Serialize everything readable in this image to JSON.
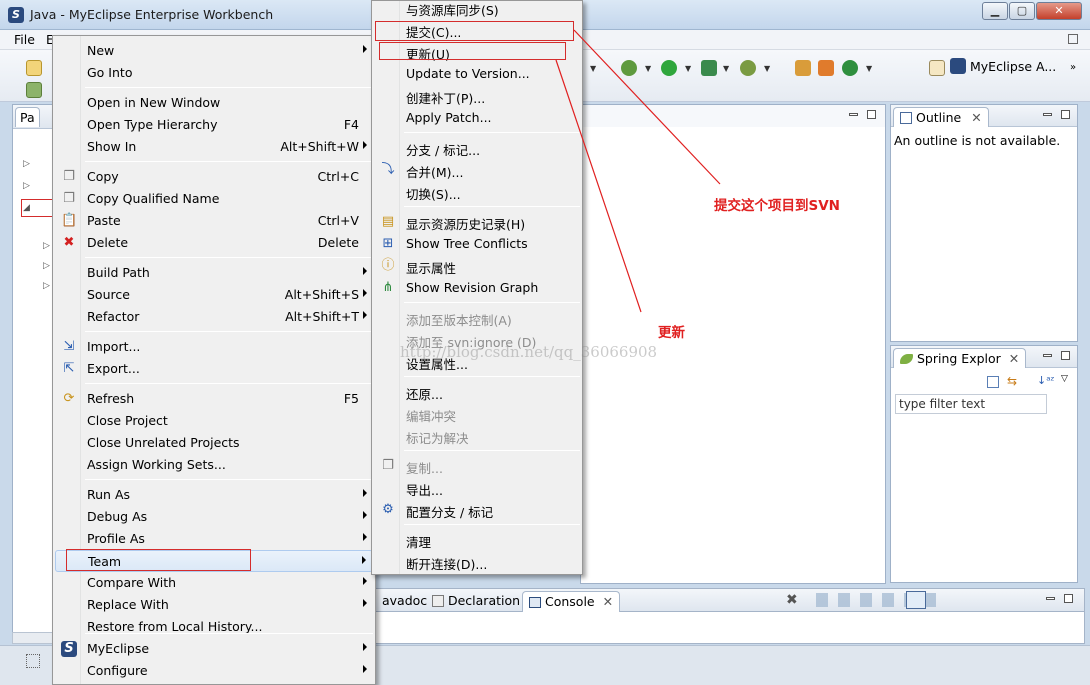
{
  "window": {
    "title": "Java - MyEclipse Enterprise Workbench",
    "min_label": "▁",
    "max_label": "▢",
    "close_label": "✕"
  },
  "menubar": {
    "file": "File",
    "edit_partial": "E"
  },
  "perspective": {
    "label": "MyEclipse A..."
  },
  "package_explorer": {
    "tab_partial": "Pa"
  },
  "outline": {
    "tab": "Outline",
    "message": "An outline is not available."
  },
  "spring": {
    "tab": "Spring Explor",
    "filter_placeholder": "type filter text"
  },
  "bottom_tabs": {
    "javadoc_partial": "avadoc",
    "declaration": "Declaration",
    "console": "Console"
  },
  "context_menu": {
    "items": [
      {
        "label": "New",
        "submenu": true
      },
      {
        "label": "Go Into"
      },
      {
        "label": "Open in New Window"
      },
      {
        "label": "Open Type Hierarchy",
        "shortcut": "F4"
      },
      {
        "label": "Show In",
        "shortcut": "Alt+Shift+W",
        "submenu": true
      },
      {
        "label": "Copy",
        "shortcut": "Ctrl+C",
        "icon": "copy-icon"
      },
      {
        "label": "Copy Qualified Name",
        "icon": "copy-qualified-icon"
      },
      {
        "label": "Paste",
        "shortcut": "Ctrl+V",
        "icon": "paste-icon"
      },
      {
        "label": "Delete",
        "shortcut": "Delete",
        "icon": "delete-icon"
      },
      {
        "label": "Build Path",
        "submenu": true
      },
      {
        "label": "Source",
        "shortcut": "Alt+Shift+S",
        "submenu": true
      },
      {
        "label": "Refactor",
        "shortcut": "Alt+Shift+T",
        "submenu": true
      },
      {
        "label": "Import...",
        "icon": "import-icon"
      },
      {
        "label": "Export...",
        "icon": "export-icon"
      },
      {
        "label": "Refresh",
        "shortcut": "F5",
        "icon": "refresh-icon"
      },
      {
        "label": "Close Project"
      },
      {
        "label": "Close Unrelated Projects"
      },
      {
        "label": "Assign Working Sets..."
      },
      {
        "label": "Run As",
        "submenu": true
      },
      {
        "label": "Debug As",
        "submenu": true
      },
      {
        "label": "Profile As",
        "submenu": true
      },
      {
        "label": "Team",
        "submenu": true,
        "highlighted": true
      },
      {
        "label": "Compare With",
        "submenu": true
      },
      {
        "label": "Replace With",
        "submenu": true
      },
      {
        "label": "Restore from Local History..."
      },
      {
        "label": "MyEclipse",
        "submenu": true,
        "icon": "myeclipse-icon"
      },
      {
        "label": "Configure",
        "submenu": true
      }
    ]
  },
  "team_menu": {
    "items": [
      {
        "label": "与资源库同步(S)"
      },
      {
        "label": "提交(C)..."
      },
      {
        "label": "更新(U)"
      },
      {
        "label": "Update to Version..."
      },
      {
        "label": "创建补丁(P)..."
      },
      {
        "label": "Apply Patch..."
      },
      {
        "label": "分支 / 标记..."
      },
      {
        "label": "合并(M)...",
        "icon": "merge-icon"
      },
      {
        "label": "切换(S)..."
      },
      {
        "label": "显示资源历史记录(H)",
        "icon": "history-icon"
      },
      {
        "label": "Show Tree Conflicts",
        "icon": "tree-conflicts-icon"
      },
      {
        "label": "显示属性",
        "icon": "properties-icon"
      },
      {
        "label": "Show Revision Graph",
        "icon": "revision-graph-icon"
      },
      {
        "label": "添加至版本控制(A)",
        "disabled": true
      },
      {
        "label": "添加至 svn:ignore (D)",
        "disabled": true
      },
      {
        "label": "设置属性..."
      },
      {
        "label": "还原..."
      },
      {
        "label": "编辑冲突",
        "disabled": true
      },
      {
        "label": "标记为解决",
        "disabled": true
      },
      {
        "label": "复制...",
        "disabled": true,
        "icon": "copy-icon"
      },
      {
        "label": "导出..."
      },
      {
        "label": "配置分支 / 标记",
        "icon": "configure-branch-icon"
      },
      {
        "label": "清理"
      },
      {
        "label": "断开连接(D)..."
      }
    ]
  },
  "annotations": {
    "commit_note": "提交这个项目到SVN",
    "update_note": "更新",
    "watermark": "http://blog.csdn.net/qq_36066908",
    "arrow_color": "#e02020"
  }
}
